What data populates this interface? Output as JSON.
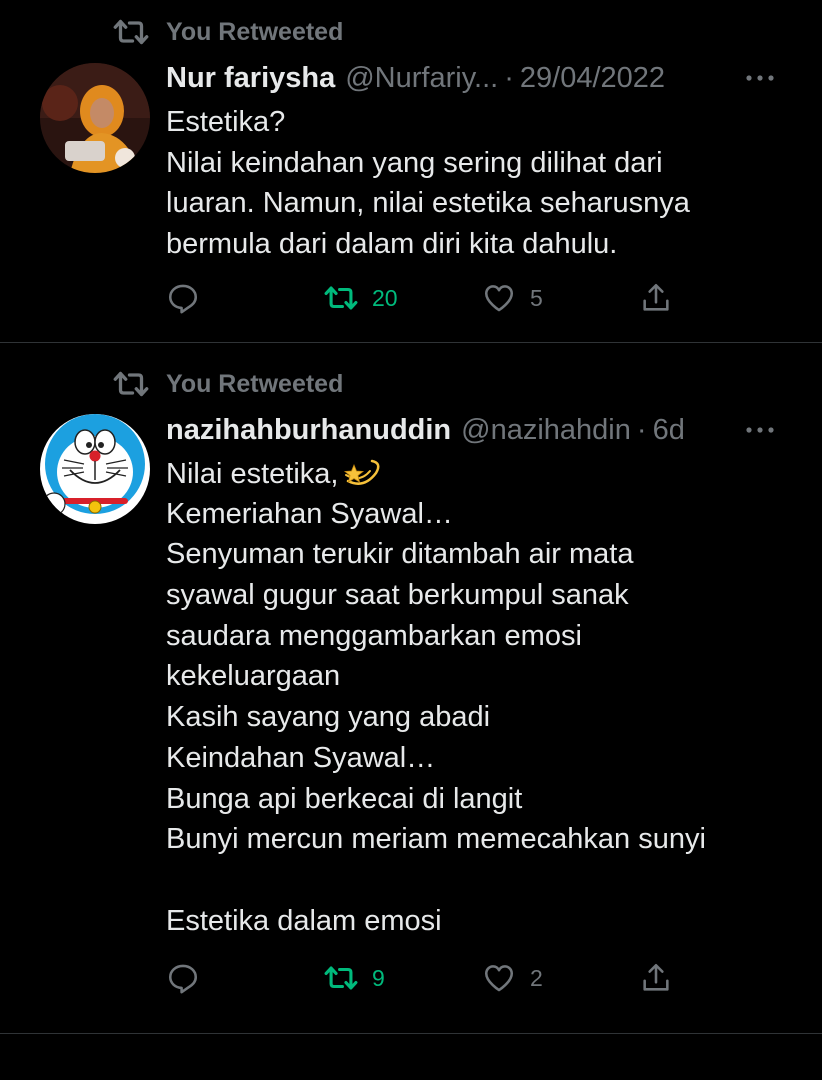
{
  "colors": {
    "background": "#000000",
    "text": "#e7e9ea",
    "secondary": "#71767b",
    "retweet_active": "#00ba7c",
    "divider": "#2f3336"
  },
  "tweets": [
    {
      "retweet_label": "You Retweeted",
      "display_name": "Nur fariysha",
      "handle": "@Nurfariy...",
      "separator": "·",
      "date": "29/04/2022",
      "avatar_icon": "profile-photo-hijab",
      "lines": [
        "Estetika?",
        "Nilai keindahan yang sering dilihat dari",
        "luaran. Namun, nilai estetika seharusnya",
        "bermula dari dalam diri kita dahulu."
      ],
      "reply_count": "",
      "retweet_count": "20",
      "like_count": "5"
    },
    {
      "retweet_label": "You Retweeted",
      "display_name": "nazihahburhanuddin",
      "handle": "@nazihahdin",
      "separator": "·",
      "date": "6d",
      "avatar_icon": "doraemon-avatar",
      "lines": [
        "Nilai estetika,",
        "Kemeriahan Syawal…",
        "Senyuman terukir ditambah air mata",
        "syawal gugur saat berkumpul sanak",
        "saudara menggambarkan emosi",
        "kekeluargaan",
        "Kasih sayang yang abadi",
        "Keindahan Syawal…",
        "Bunga api berkecai di langit",
        "Bunyi mercun meriam memecahkan sunyi",
        "",
        "Estetika dalam emosi"
      ],
      "reply_count": "",
      "retweet_count": "9",
      "like_count": "2"
    }
  ]
}
